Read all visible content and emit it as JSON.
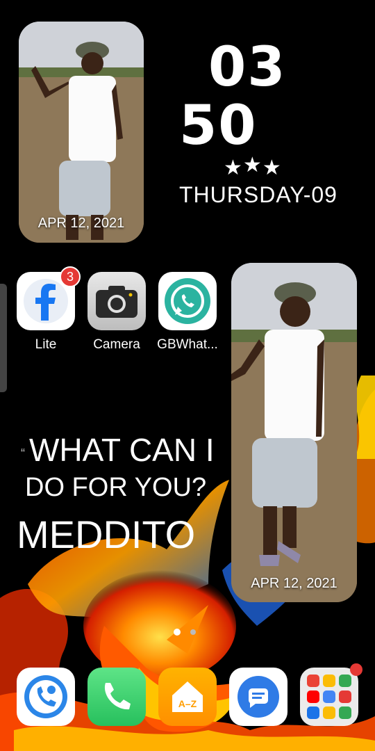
{
  "clock": {
    "hours": "03",
    "minutes": "50",
    "stars": "★★★",
    "day": "THURSDAY-09"
  },
  "photo_widgets": [
    {
      "date": "APR 12, 2021"
    },
    {
      "date": "APR 12, 2021"
    }
  ],
  "apps": [
    {
      "label": "Lite",
      "badge": "3",
      "icon": "facebook-lite-icon"
    },
    {
      "label": "Camera",
      "icon": "camera-icon"
    },
    {
      "label": "GBWhat...",
      "icon": "whatsapp-icon"
    }
  ],
  "quote": {
    "mark": "“",
    "line1": "WHAT CAN I",
    "line2": "DO FOR YOU?",
    "author": "MEDDITO"
  },
  "dock": [
    {
      "icon": "contacts-icon"
    },
    {
      "icon": "phone-icon"
    },
    {
      "icon": "app-index-icon",
      "text": "A–Z"
    },
    {
      "icon": "messages-icon"
    },
    {
      "icon": "google-folder-icon"
    }
  ],
  "colors": {
    "facebook_blue": "#1877f2",
    "whatsapp_green": "#25a55f",
    "phone_green": "#3bd16f",
    "az_orange": "#ff9d00",
    "messages_blue": "#2f7be6",
    "badge_red": "#e53935"
  }
}
